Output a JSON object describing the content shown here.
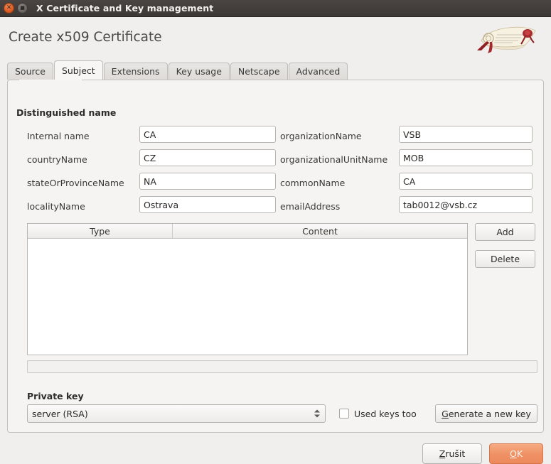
{
  "window": {
    "title": "X Certificate and Key management",
    "close_icon": "close-icon",
    "maximize_icon": "maximize-icon",
    "close_glyph": "✕",
    "maximize_glyph": "■"
  },
  "header": {
    "title": "Create x509 Certificate",
    "logo_alt": "certificate-scroll-logo"
  },
  "tabs": [
    {
      "label": "Source",
      "active": false
    },
    {
      "label": "Subject",
      "active": true
    },
    {
      "label": "Extensions",
      "active": false
    },
    {
      "label": "Key usage",
      "active": false
    },
    {
      "label": "Netscape",
      "active": false
    },
    {
      "label": "Advanced",
      "active": false
    }
  ],
  "subject": {
    "section_title": "Distinguished name",
    "fields_left": [
      {
        "label": "Internal name",
        "value": "CA"
      },
      {
        "label": "countryName",
        "value": "CZ"
      },
      {
        "label": "stateOrProvinceName",
        "value": "NA"
      },
      {
        "label": "localityName",
        "value": "Ostrava"
      }
    ],
    "fields_right": [
      {
        "label": "organizationName",
        "value": "VSB"
      },
      {
        "label": "organizationalUnitName",
        "value": "MOB"
      },
      {
        "label": "commonName",
        "value": "CA"
      },
      {
        "label": "emailAddress",
        "value": "tab0012@vsb.cz"
      }
    ],
    "table": {
      "columns": [
        "Type",
        "Content"
      ],
      "rows": []
    },
    "add_label": "Add",
    "delete_label": "Delete"
  },
  "private_key": {
    "section_title": "Private key",
    "selected": "server (RSA)",
    "used_keys_label": "Used keys too",
    "used_keys_checked": false,
    "generate_label_pre": "",
    "generate_label_mnemonic": "G",
    "generate_label_post": "enerate a new key"
  },
  "footer": {
    "cancel_mnemonic": "Z",
    "cancel_post": "rušit",
    "ok_mnemonic": "O",
    "ok_post": "K"
  },
  "colors": {
    "accent_ok": "#ef9064",
    "titlebar": "#3c3835",
    "panel": "#f5f4f3",
    "window_bg": "#f0efee"
  }
}
